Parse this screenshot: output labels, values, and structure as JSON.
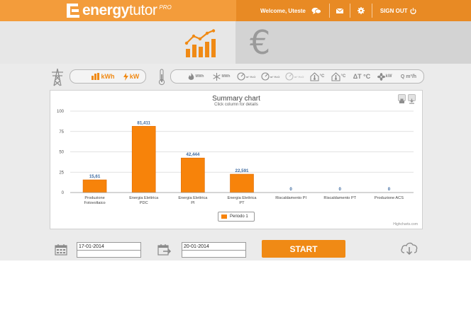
{
  "app": {
    "brand_bold": "energy",
    "brand_light": "tutor",
    "brand_pro": "PRO"
  },
  "topbar": {
    "welcome": "Welcome, Uteste",
    "signout": "SIGN OUT",
    "icons": [
      "chat-icon",
      "mail-icon",
      "settings-icon",
      "power-icon"
    ]
  },
  "modes": {
    "energy_icon": "bar-chart-trend-icon",
    "currency_icon": "euro-icon",
    "currency_symbol": "€"
  },
  "toolbar": {
    "units": [
      {
        "name": "kwh-button",
        "icon": "bar-chart-icon",
        "label": "kWh"
      },
      {
        "name": "kw-button",
        "icon": "lightning-icon",
        "label": "kW"
      }
    ],
    "thermal": [
      {
        "name": "heating-mwh-button",
        "label": "MWh",
        "icon": "flame-icon"
      },
      {
        "name": "cooling-mwh-button",
        "label": "MWh",
        "icon": "snowflake-icon"
      },
      {
        "name": "water-volume-1-button",
        "label": "m³ H₂O",
        "icon": "meter-icon"
      },
      {
        "name": "water-volume-2-button",
        "label": "m³ H₂O",
        "icon": "meter-icon"
      },
      {
        "name": "water-volume-3-button",
        "label": "m³ H₂O",
        "icon": "meter-icon"
      },
      {
        "name": "temp-out-button",
        "label": "°C",
        "icon": "house-temp-icon"
      },
      {
        "name": "temp-in-button",
        "label": "°C",
        "icon": "house-temp-icon"
      },
      {
        "name": "delta-t-button",
        "label": "ΔT °C",
        "icon": "delta-icon"
      },
      {
        "name": "power-kw-button",
        "label": "kW",
        "icon": "fan-icon"
      },
      {
        "name": "flow-button",
        "label": "Q m³/h",
        "icon": "flow-icon"
      }
    ]
  },
  "chart_data": {
    "type": "bar",
    "title": "Summary chart",
    "subtitle": "Click column for details",
    "categories": [
      "Produzione Fotovoltaico",
      "Energia Elettrica PDC",
      "Energia Elettrica PI",
      "Energia Elettrica PT",
      "Riscaldamento PI",
      "Riscaldamento PT",
      "Produzione ACS"
    ],
    "category_lines": [
      [
        "Produzione",
        "Fotovoltaico"
      ],
      [
        "Energia Elettrica",
        "PDC"
      ],
      [
        "Energia Elettrica",
        "PI"
      ],
      [
        "Energia Elettrica",
        "PT"
      ],
      [
        "Riscaldamento PI"
      ],
      [
        "Riscaldamento PT"
      ],
      [
        "Produzione ACS"
      ]
    ],
    "series": [
      {
        "name": "Periodo 1",
        "values": [
          15.61,
          81.411,
          42.444,
          22.591,
          0,
          0,
          0
        ],
        "labels": [
          "15,61",
          "81,411",
          "42,444",
          "22,591",
          "0",
          "0",
          "0"
        ],
        "color": "#f7830a"
      }
    ],
    "yticks": [
      "0",
      "25",
      "50",
      "75",
      "100"
    ],
    "ylim": [
      0,
      100
    ],
    "grid": true,
    "legend_position": "bottom-center",
    "credit": "Highcharts.com",
    "label_color": "#3d6aa0"
  },
  "dates": {
    "from_value": "17-01-2014",
    "to_value": "20-01-2014",
    "start_label": "START",
    "calendar_icon": "calendar-icon",
    "calendar_arrow_icon": "calendar-next-icon",
    "download_icon": "cloud-download-icon"
  },
  "colors": {
    "accent": "#f39c3b",
    "accent_dark": "#e88a24",
    "bar": "#f7830a",
    "bar_border": "#e06a00",
    "background": "#ebebeb"
  }
}
